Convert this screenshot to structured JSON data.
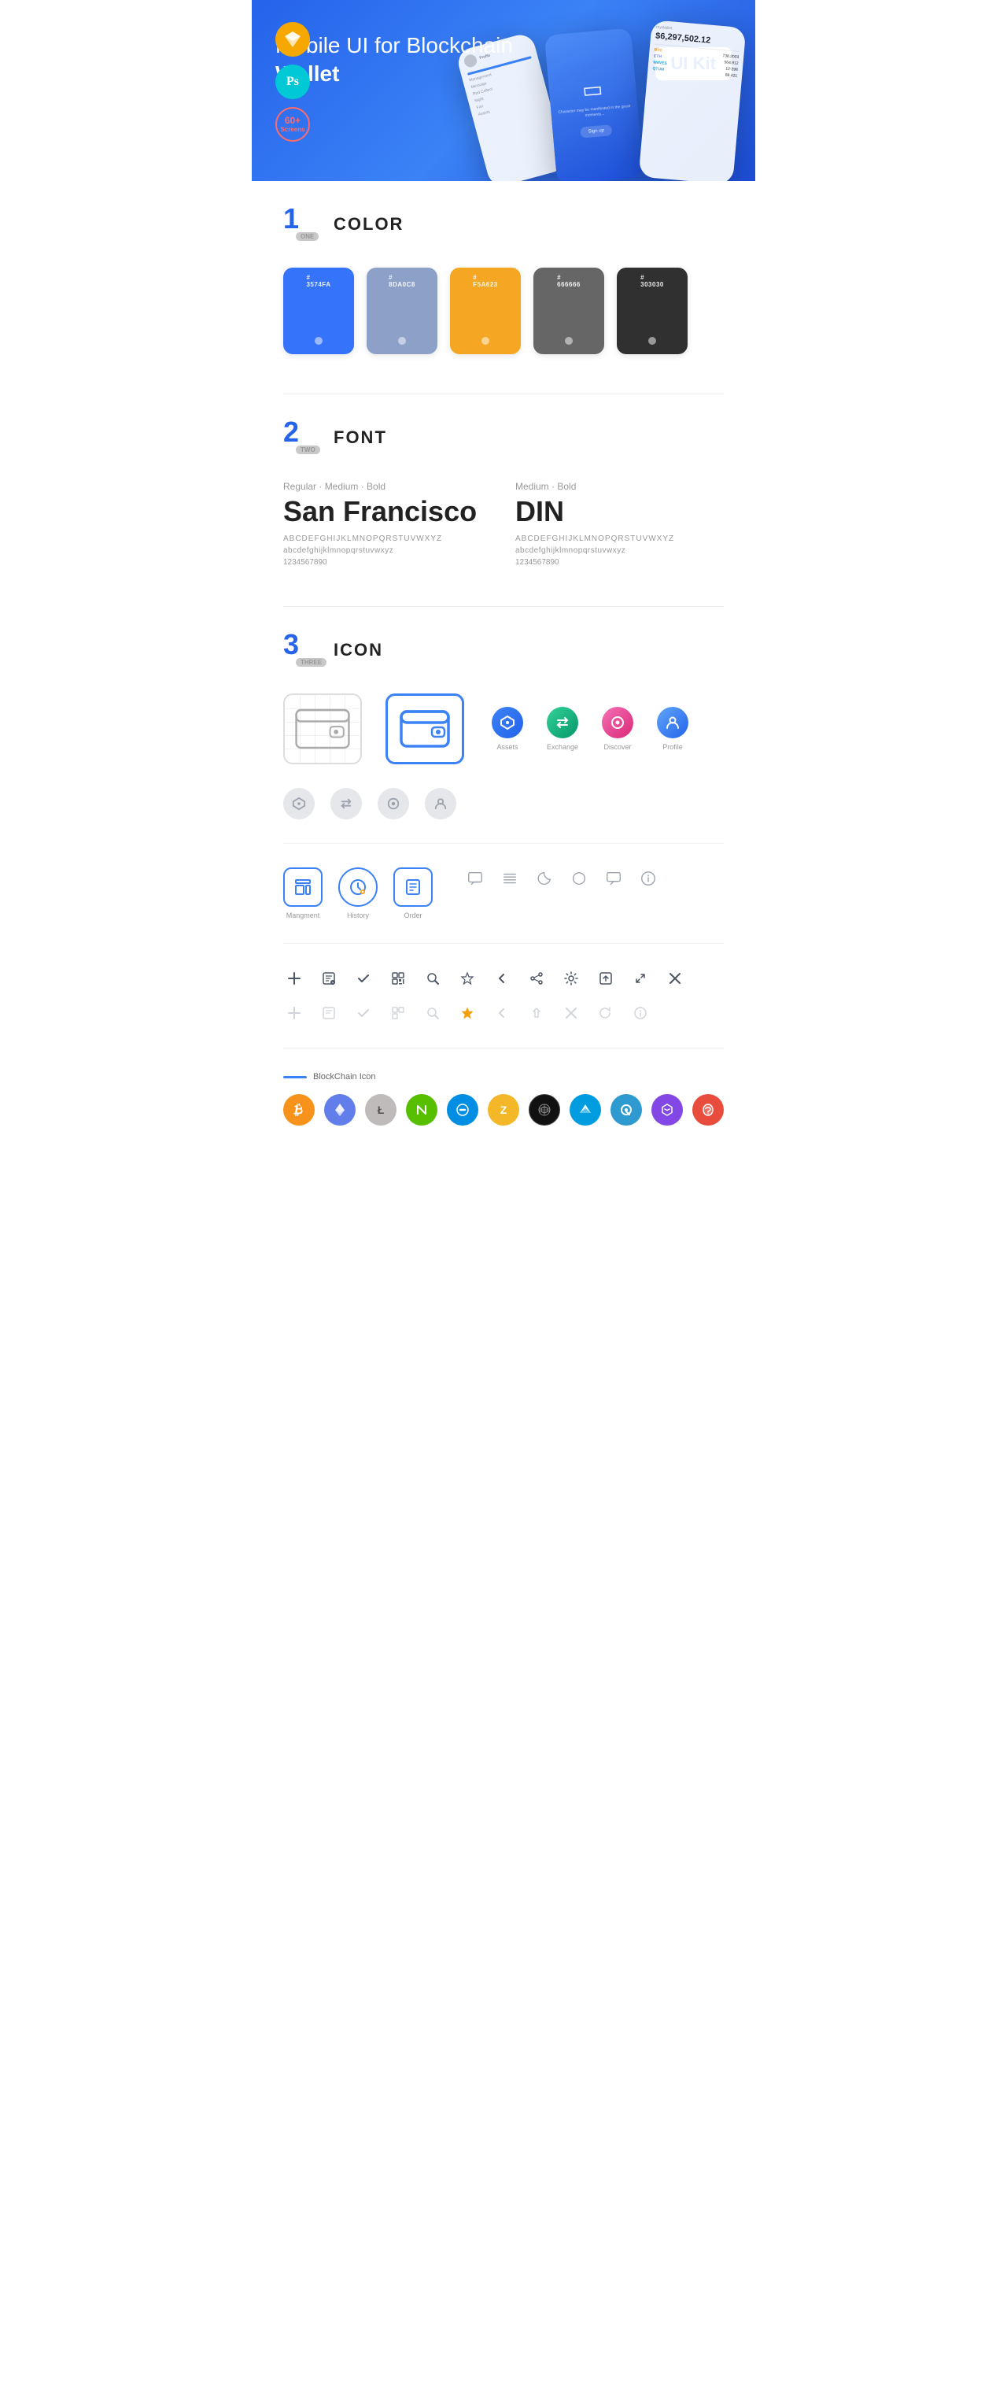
{
  "hero": {
    "title_start": "Mobile UI for Blockchain ",
    "title_bold": "Wallet",
    "ui_kit_badge": "UI Kit",
    "badges": [
      {
        "id": "sketch",
        "label": "Sk",
        "type": "sketch"
      },
      {
        "id": "ps",
        "label": "Ps",
        "type": "ps"
      },
      {
        "id": "screens",
        "line1": "60+",
        "line2": "Screens",
        "type": "screens"
      }
    ]
  },
  "sections": {
    "color": {
      "number": "1",
      "number_label": "ONE",
      "title": "COLOR",
      "swatches": [
        {
          "id": "blue",
          "hex": "#3574FA",
          "code": "#3574FA",
          "bg": "#3574FA"
        },
        {
          "id": "gray-blue",
          "hex": "#8DA0C8",
          "code": "#8DA0C8",
          "bg": "#8DA0C8"
        },
        {
          "id": "orange",
          "hex": "#F5A623",
          "code": "#F5A623",
          "bg": "#F5A623"
        },
        {
          "id": "gray",
          "hex": "#666666",
          "code": "#666666",
          "bg": "#666666"
        },
        {
          "id": "dark",
          "hex": "#303030",
          "code": "#303030",
          "bg": "#303030"
        }
      ]
    },
    "font": {
      "number": "2",
      "number_label": "TWO",
      "title": "FONT",
      "fonts": [
        {
          "id": "sf",
          "weight_label": "Regular · Medium · Bold",
          "name": "San Francisco",
          "uppercase": "ABCDEFGHIJKLMNOPQRSTUVWXYZ",
          "lowercase": "abcdefghijklmnopqrstuvwxyz",
          "numbers": "1234567890"
        },
        {
          "id": "din",
          "weight_label": "Medium · Bold",
          "name": "DIN",
          "uppercase": "ABCDEFGHIJKLMNOPQRSTUVWXYZ",
          "lowercase": "abcdefghijklmnopqrstuvwxyz",
          "numbers": "1234567890"
        }
      ]
    },
    "icon": {
      "number": "3",
      "number_label": "THREE",
      "title": "ICON",
      "nav_icons": [
        {
          "id": "assets",
          "label": "Assets",
          "symbol": "◆"
        },
        {
          "id": "exchange",
          "label": "Exchange",
          "symbol": "⇄"
        },
        {
          "id": "discover",
          "label": "Discover",
          "symbol": "◉"
        },
        {
          "id": "profile",
          "label": "Profile",
          "symbol": "👤"
        }
      ],
      "mid_icons": [
        {
          "id": "management",
          "label": "Mangment",
          "type": "box"
        },
        {
          "id": "history",
          "label": "History",
          "type": "circle"
        },
        {
          "id": "order",
          "label": "Order",
          "type": "box"
        }
      ],
      "blockchain_label": "BlockChain Icon",
      "crypto_coins": [
        {
          "id": "btc",
          "symbol": "₿",
          "class": "crypto-btc"
        },
        {
          "id": "eth",
          "symbol": "Ξ",
          "class": "crypto-eth"
        },
        {
          "id": "ltc",
          "symbol": "Ł",
          "class": "crypto-ltc"
        },
        {
          "id": "neo",
          "symbol": "N",
          "class": "crypto-neo"
        },
        {
          "id": "dash",
          "symbol": "D",
          "class": "crypto-dash"
        },
        {
          "id": "zcash",
          "symbol": "Z",
          "class": "crypto-zcash"
        },
        {
          "id": "grid",
          "symbol": "⊞",
          "class": "crypto-grid"
        },
        {
          "id": "waves",
          "symbol": "W",
          "class": "crypto-waves"
        },
        {
          "id": "qtum",
          "symbol": "Q",
          "class": "crypto-qtum"
        },
        {
          "id": "matic",
          "symbol": "M",
          "class": "crypto-matic"
        },
        {
          "id": "unknown",
          "symbol": "●",
          "class": "crypto-unknown"
        }
      ]
    }
  }
}
